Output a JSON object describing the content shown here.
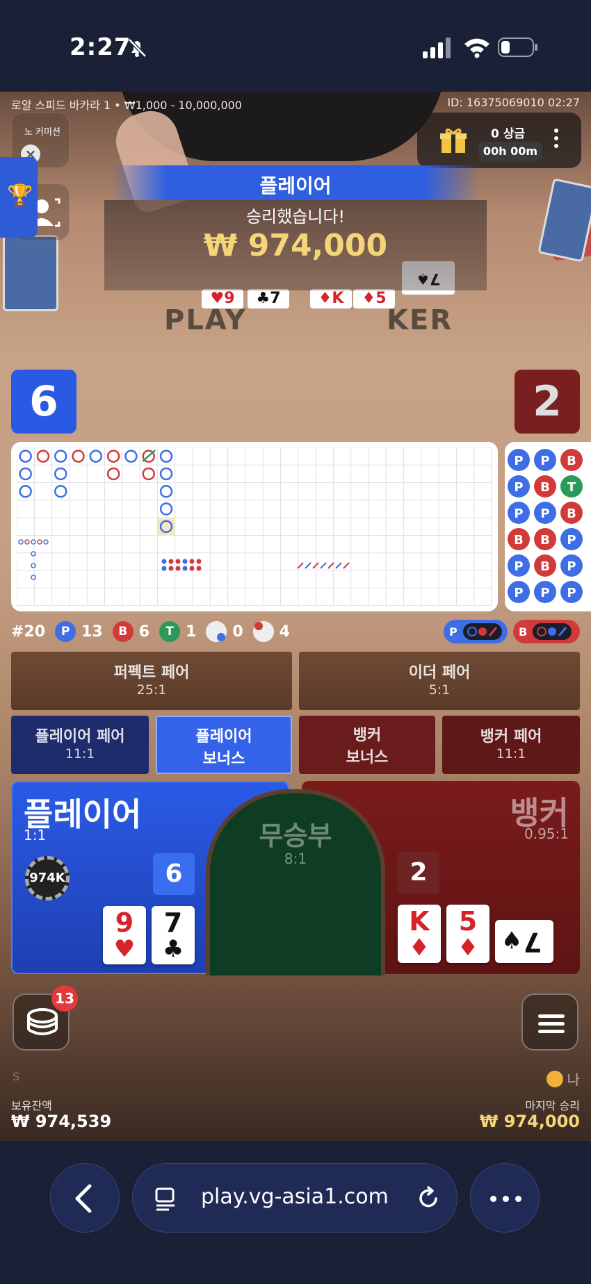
{
  "status_bar": {
    "time": "2:27"
  },
  "game": {
    "table_info": "로얄 스피드 바카라 1 • ₩1,000 - 10,000,000",
    "round_id": "ID: 16375069010 02:27",
    "no_commission": "노 커미션",
    "prize": {
      "label": "0 상금",
      "timer": "00h 00m"
    }
  },
  "win": {
    "side": "플레이어",
    "message": "승리했습니다!",
    "amount": "₩ 974,000",
    "board_left": "PLAY",
    "board_right": "KER"
  },
  "scores": {
    "player": "6",
    "banker": "2"
  },
  "stats": {
    "round": "#20",
    "player_label": "P",
    "player_count": "13",
    "banker_label": "B",
    "banker_count": "6",
    "tie_label": "T",
    "tie_count": "1",
    "player_pair_count": "0",
    "banker_pair_count": "4",
    "predict_player": "P",
    "predict_banker": "B"
  },
  "bets": {
    "perfect_pair": {
      "name": "퍼펙트 페어",
      "odds": "25:1"
    },
    "either_pair": {
      "name": "이더 페어",
      "odds": "5:1"
    },
    "player_pair": {
      "name": "플레이어 페어",
      "odds": "11:1"
    },
    "player_bonus": {
      "name1": "플레이어",
      "name2": "보너스"
    },
    "banker_bonus": {
      "name1": "뱅커",
      "name2": "보너스"
    },
    "banker_pair": {
      "name": "뱅커 페어",
      "odds": "11:1"
    },
    "player": {
      "name": "플레이어",
      "odds": "1:1",
      "chip": "974K",
      "total": "6",
      "cards": [
        {
          "rank": "9",
          "suit": "♥",
          "color": "#d5232a"
        },
        {
          "rank": "7",
          "suit": "♣",
          "color": "#111111"
        }
      ]
    },
    "tie": {
      "name": "무승부",
      "odds": "8:1"
    },
    "banker": {
      "name": "뱅커",
      "odds": "0.95:1",
      "total": "2",
      "cards": [
        {
          "rank": "K",
          "suit": "♦",
          "color": "#d5232a"
        },
        {
          "rank": "5",
          "suit": "♦",
          "color": "#d5232a"
        },
        {
          "rank": "7",
          "suit": "♠",
          "color": "#111111"
        }
      ]
    }
  },
  "bottom": {
    "chip_badge": "13",
    "s_mark": "S",
    "na_label": "나",
    "balance_label": "보유잔액",
    "balance_value": "₩ 974,539",
    "last_win_label": "마지막 승리",
    "last_win_value": "₩ 974,000"
  },
  "browser": {
    "url": "play.vg-asia1.com"
  },
  "bead_road": [
    [
      "P",
      "P",
      "B"
    ],
    [
      "P",
      "B",
      "T"
    ],
    [
      "P",
      "P",
      "B"
    ],
    [
      "B",
      "B",
      "P"
    ],
    [
      "P",
      "B",
      "P"
    ],
    [
      "P",
      "P",
      "P"
    ]
  ],
  "colors": {
    "player": "#2a5ae3",
    "banker": "#7a1f1f",
    "tie": "#0f3d23",
    "gold": "#f6d57a"
  }
}
